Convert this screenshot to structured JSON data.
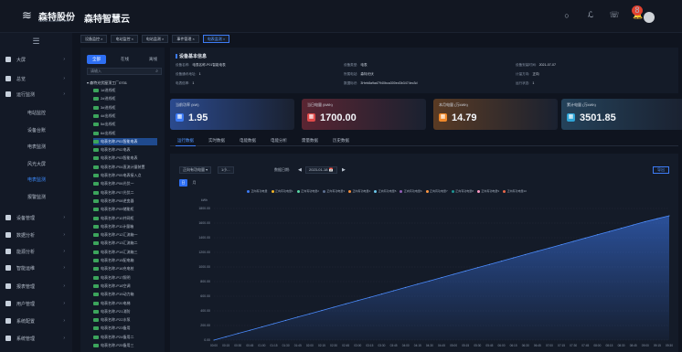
{
  "header": {
    "logo_text": "森特股份",
    "logo_sub": "SENTE BUILDING TECH",
    "app_title": "森特智慧云",
    "notification_count": "8"
  },
  "sidebar": {
    "items": [
      {
        "label": "大屏",
        "icon": "screen-icon"
      },
      {
        "label": "总览",
        "icon": "dashboard-icon"
      },
      {
        "label": "运行监测",
        "icon": "monitor-icon"
      },
      {
        "label": "电站监控",
        "icon": "",
        "sub": true
      },
      {
        "label": "设备台账",
        "icon": "",
        "sub": true
      },
      {
        "label": "电表监测",
        "icon": "",
        "sub": true
      },
      {
        "label": "风光大屏",
        "icon": "",
        "sub": true
      },
      {
        "label": "电表监测",
        "icon": "",
        "sub": true,
        "active": true
      },
      {
        "label": "报警监测",
        "icon": "",
        "sub": true
      },
      {
        "label": "设备管理",
        "icon": "device-icon"
      },
      {
        "label": "数据分析",
        "icon": "analysis-icon"
      },
      {
        "label": "能源分析",
        "icon": "energy-icon"
      },
      {
        "label": "智能运维",
        "icon": "maintenance-icon"
      },
      {
        "label": "报表管理",
        "icon": "report-icon"
      },
      {
        "label": "用户管理",
        "icon": "user-icon"
      },
      {
        "label": "系统配置",
        "icon": "settings-icon"
      },
      {
        "label": "系统管理",
        "icon": "system-icon"
      }
    ]
  },
  "filters": [
    "设备监控 ×",
    "电站监控 ×",
    "电站监测 ×",
    "事件管理 ×",
    "电表监测 ×"
  ],
  "tree": {
    "tabs": [
      "全部",
      "在线",
      "离线"
    ],
    "search_placeholder": "请输入",
    "root": "▾ 森特光伏屋顶工厂0701",
    "nodes": [
      "1#进线柜",
      "2#进线柜",
      "3#进线柜",
      "4#出线柜",
      "5#出线柜",
      "6#出线柜",
      "电表名称-P01智能电表",
      "电表名称-P02电表",
      "电表名称-P03智能电表",
      "电表名称-P04直流计量装置",
      "电表名称-P05电表接入点",
      "电表名称-P06光伏一",
      "电表名称-P07光伏二",
      "电表名称-P08逆变器",
      "电表名称-P09储能柜",
      "电表名称-P10并网柜",
      "电表名称-P11计量箱",
      "电表名称-P12汇流箱一",
      "电表名称-P13汇流箱二",
      "电表名称-P14汇流箱三",
      "电表名称-P15配电箱",
      "电表名称-P16充电桩",
      "电表名称-P17照明",
      "电表名称-P18空调",
      "电表名称-P19动力箱",
      "电表名称-P20电梯",
      "电表名称-P21消防",
      "电表名称-P22水泵",
      "电表名称-P23备用",
      "电表名称-P24备用二",
      "电表名称-P25备用三"
    ]
  },
  "device_info": {
    "title": "设备基本信息",
    "fields": [
      {
        "k": "设备名称:",
        "v": "电表名称-P01智能电表"
      },
      {
        "k": "设备类型:",
        "v": "电表"
      },
      {
        "k": "设备安装时间:",
        "v": "2021-07-07"
      },
      {
        "k": "设备通讯地址:",
        "v": "1"
      },
      {
        "k": "所属电站:",
        "v": "森特光伏"
      },
      {
        "k": "计量方向:",
        "v": "正向"
      },
      {
        "k": "电表倍率:",
        "v": "1"
      },
      {
        "k": "数据标识:",
        "v": "3Heb8a9ad7940bca300ed3b3474ec3d"
      },
      {
        "k": "运行状态:",
        "v": "1"
      }
    ]
  },
  "cards": [
    {
      "label": "当前功率 (kW)",
      "value": "1.95",
      "color": "#2b4a8e",
      "icon_color": "#3d7bf5"
    },
    {
      "label": "当日电量 (kWh)",
      "value": "1700.00",
      "color": "#5a2532",
      "icon_color": "#e04a4a"
    },
    {
      "label": "本月电量 (万kWh)",
      "value": "14.79",
      "color": "#5a3b24",
      "icon_color": "#f0892b"
    },
    {
      "label": "累计电量 (万kWh)",
      "value": "3501.85",
      "color": "#24425a",
      "icon_color": "#2fa6d8"
    }
  ],
  "tabs": [
    "运行数据",
    "实时数据",
    "电能数据",
    "电能分析",
    "需量数据",
    "历史数据"
  ],
  "chart_controls": {
    "type_select": "正向有功电量",
    "select2": "1小...",
    "date_label": "数据日期:",
    "date": "2023-01-18",
    "export": "导出",
    "mode_on": "日",
    "mode_off": "月"
  },
  "chart_data": {
    "type": "area",
    "ylabel": "kWh",
    "ylim": [
      0,
      1800
    ],
    "yticks": [
      0,
      200,
      400,
      600,
      800,
      1000,
      1200,
      1400,
      1600,
      1800
    ],
    "x": [
      "00:00",
      "00:15",
      "00:30",
      "00:45",
      "01:00",
      "01:15",
      "01:30",
      "01:45",
      "02:00",
      "02:15",
      "02:30",
      "02:45",
      "03:00",
      "03:15",
      "03:30",
      "03:45",
      "04:00",
      "04:15",
      "04:30",
      "04:45",
      "05:00",
      "05:15",
      "05:30",
      "05:45",
      "06:00",
      "06:15",
      "06:30",
      "06:45",
      "07:00",
      "07:15",
      "07:30",
      "07:45",
      "08:00",
      "08:15",
      "08:30",
      "08:45",
      "09:00",
      "09:15",
      "09:30"
    ],
    "series": [
      {
        "name": "正向有功电量",
        "values": [
          0,
          45,
          90,
          135,
          180,
          225,
          270,
          315,
          360,
          405,
          450,
          495,
          540,
          585,
          630,
          675,
          720,
          765,
          810,
          855,
          900,
          945,
          990,
          1035,
          1080,
          1125,
          1170,
          1215,
          1260,
          1305,
          1350,
          1395,
          1440,
          1485,
          1530,
          1575,
          1620,
          1660,
          1700
        ]
      }
    ],
    "legend": [
      "正向有功电量",
      "正向有功电量1",
      "正向有功电量2",
      "正向有功电量3",
      "正向有功电量4",
      "正向有功电量5",
      "正向有功电量6",
      "正向有功电量7",
      "正向有功电量8",
      "正向有功电量9",
      "正向有功电量10"
    ],
    "legend_colors": [
      "#3d7bf5",
      "#f0b429",
      "#5ad8a6",
      "#5d7092",
      "#f6903d",
      "#6dc8ec",
      "#945fb9",
      "#ff9845",
      "#1e9493",
      "#ff99c3",
      "#e8684a"
    ],
    "grid": true
  }
}
